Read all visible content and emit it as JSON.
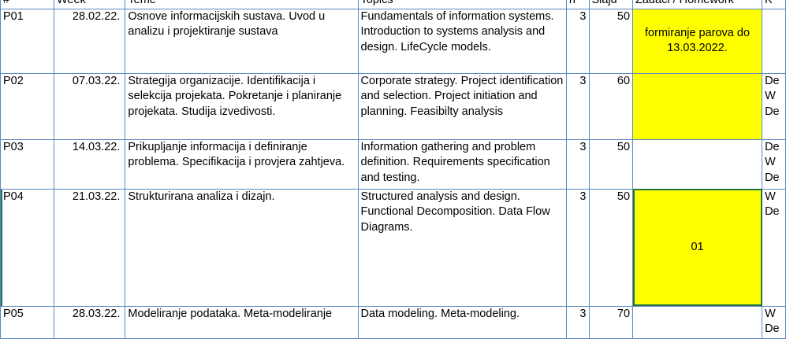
{
  "header": {
    "col_hash": "#",
    "col_week": "Week",
    "col_teme": "Teme",
    "col_topics": "Topics",
    "col_h": "h",
    "col_slajdovi": "Slajd",
    "col_zadaci": "Zadaci / Homework",
    "col_extra": "K"
  },
  "rows": [
    {
      "id": "P01",
      "date": "28.02.22.",
      "teme": "Osnove informacijskih sustava. Uvod u analizu i projektiranje sustava",
      "topics": "Fundamentals of information systems. Introduction to systems analysis and design. LifeCycle models.",
      "h": "3",
      "n": "50",
      "zadaci": "formiranje parova do 13.03.2022.",
      "extra": ""
    },
    {
      "id": "P02",
      "date": "07.03.22.",
      "teme": "Strategija organizacije. Identifikacija i selekcija projekata. Pokretanje i planiranje projekata. Studija izvedivosti.",
      "topics": "Corporate strategy. Project identification and selection. Project initiation and planning. Feasibilty analysis",
      "h": "3",
      "n": "60",
      "zadaci": "",
      "extra": "De W De"
    },
    {
      "id": "P03",
      "date": "14.03.22.",
      "teme": "Prikupljanje informacija i definiranje problema. Specifikacija i provjera zahtjeva.",
      "topics": "Information gathering and problem definition. Requirements specification and testing.",
      "h": "3",
      "n": "50",
      "zadaci": "",
      "extra": "De W De"
    },
    {
      "id": "P04",
      "date": "21.03.22.",
      "teme": "Strukturirana analiza i dizajn.",
      "topics": "Structured analysis and design. Functional Decomposition. Data Flow Diagrams.",
      "h": "3",
      "n": "50",
      "zadaci": "01",
      "extra": "W De"
    },
    {
      "id": "P05",
      "date": "28.03.22.",
      "teme": "Modeliranje podataka. Meta-modeliranje",
      "topics": "Data modeling. Meta-modeling.",
      "h": "3",
      "n": "70",
      "zadaci": "",
      "extra": "W De"
    }
  ],
  "colors": {
    "grid": "#5a88c0",
    "highlight": "#ffff00",
    "selection": "#217346"
  }
}
